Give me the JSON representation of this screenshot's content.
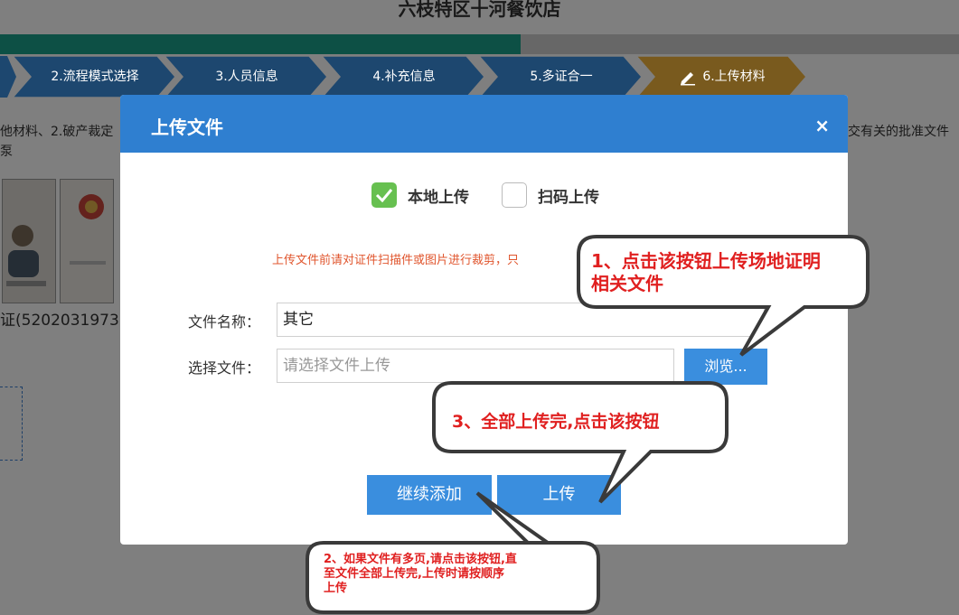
{
  "page": {
    "title": "六枝特区十河餐饮店",
    "progress_fraction": 0.543
  },
  "steps": [
    {
      "label": "2.流程模式选择",
      "active": false
    },
    {
      "label": "3.人员信息",
      "active": false
    },
    {
      "label": "4.补充信息",
      "active": false
    },
    {
      "label": "5.多证合一",
      "active": false
    },
    {
      "label": "6.上传材料",
      "active": true
    }
  ],
  "background": {
    "line1_left": "他材料、2.破产裁定",
    "line1_right": "交有关的批准文件",
    "line2": "泵",
    "id_caption": "证(5202031973"
  },
  "modal": {
    "title": "上传文件",
    "close_label": "×",
    "option_local": "本地上传",
    "option_scan": "扫码上传",
    "hint": "上传文件前请对证件扫描件或图片进行裁剪，只",
    "file_name_label": "文件名称：",
    "file_name_value": "其它",
    "select_file_label": "选择文件：",
    "select_file_placeholder": "请选择文件上传",
    "browse_label": "浏览...",
    "continue_label": "继续添加",
    "upload_label": "上传"
  },
  "callouts": {
    "c1_line1": "1、点击该按钮上传场地证明",
    "c1_line2": "相关文件",
    "c2_line1": "2、如果文件有多页,请点击该按钮,直",
    "c2_line2": "至文件全部上传完,上传时请按顺序",
    "c2_line3": "上传",
    "c3": "3、全部上传完,点击该按钮"
  },
  "colors": {
    "accent": "#2f7fd0",
    "button": "#3a8ede",
    "step_blue": "#3a8ede",
    "step_active": "#f2b43c",
    "checkbox_green": "#67c050",
    "hint_red": "#e0552d",
    "callout_red": "#e02020"
  }
}
